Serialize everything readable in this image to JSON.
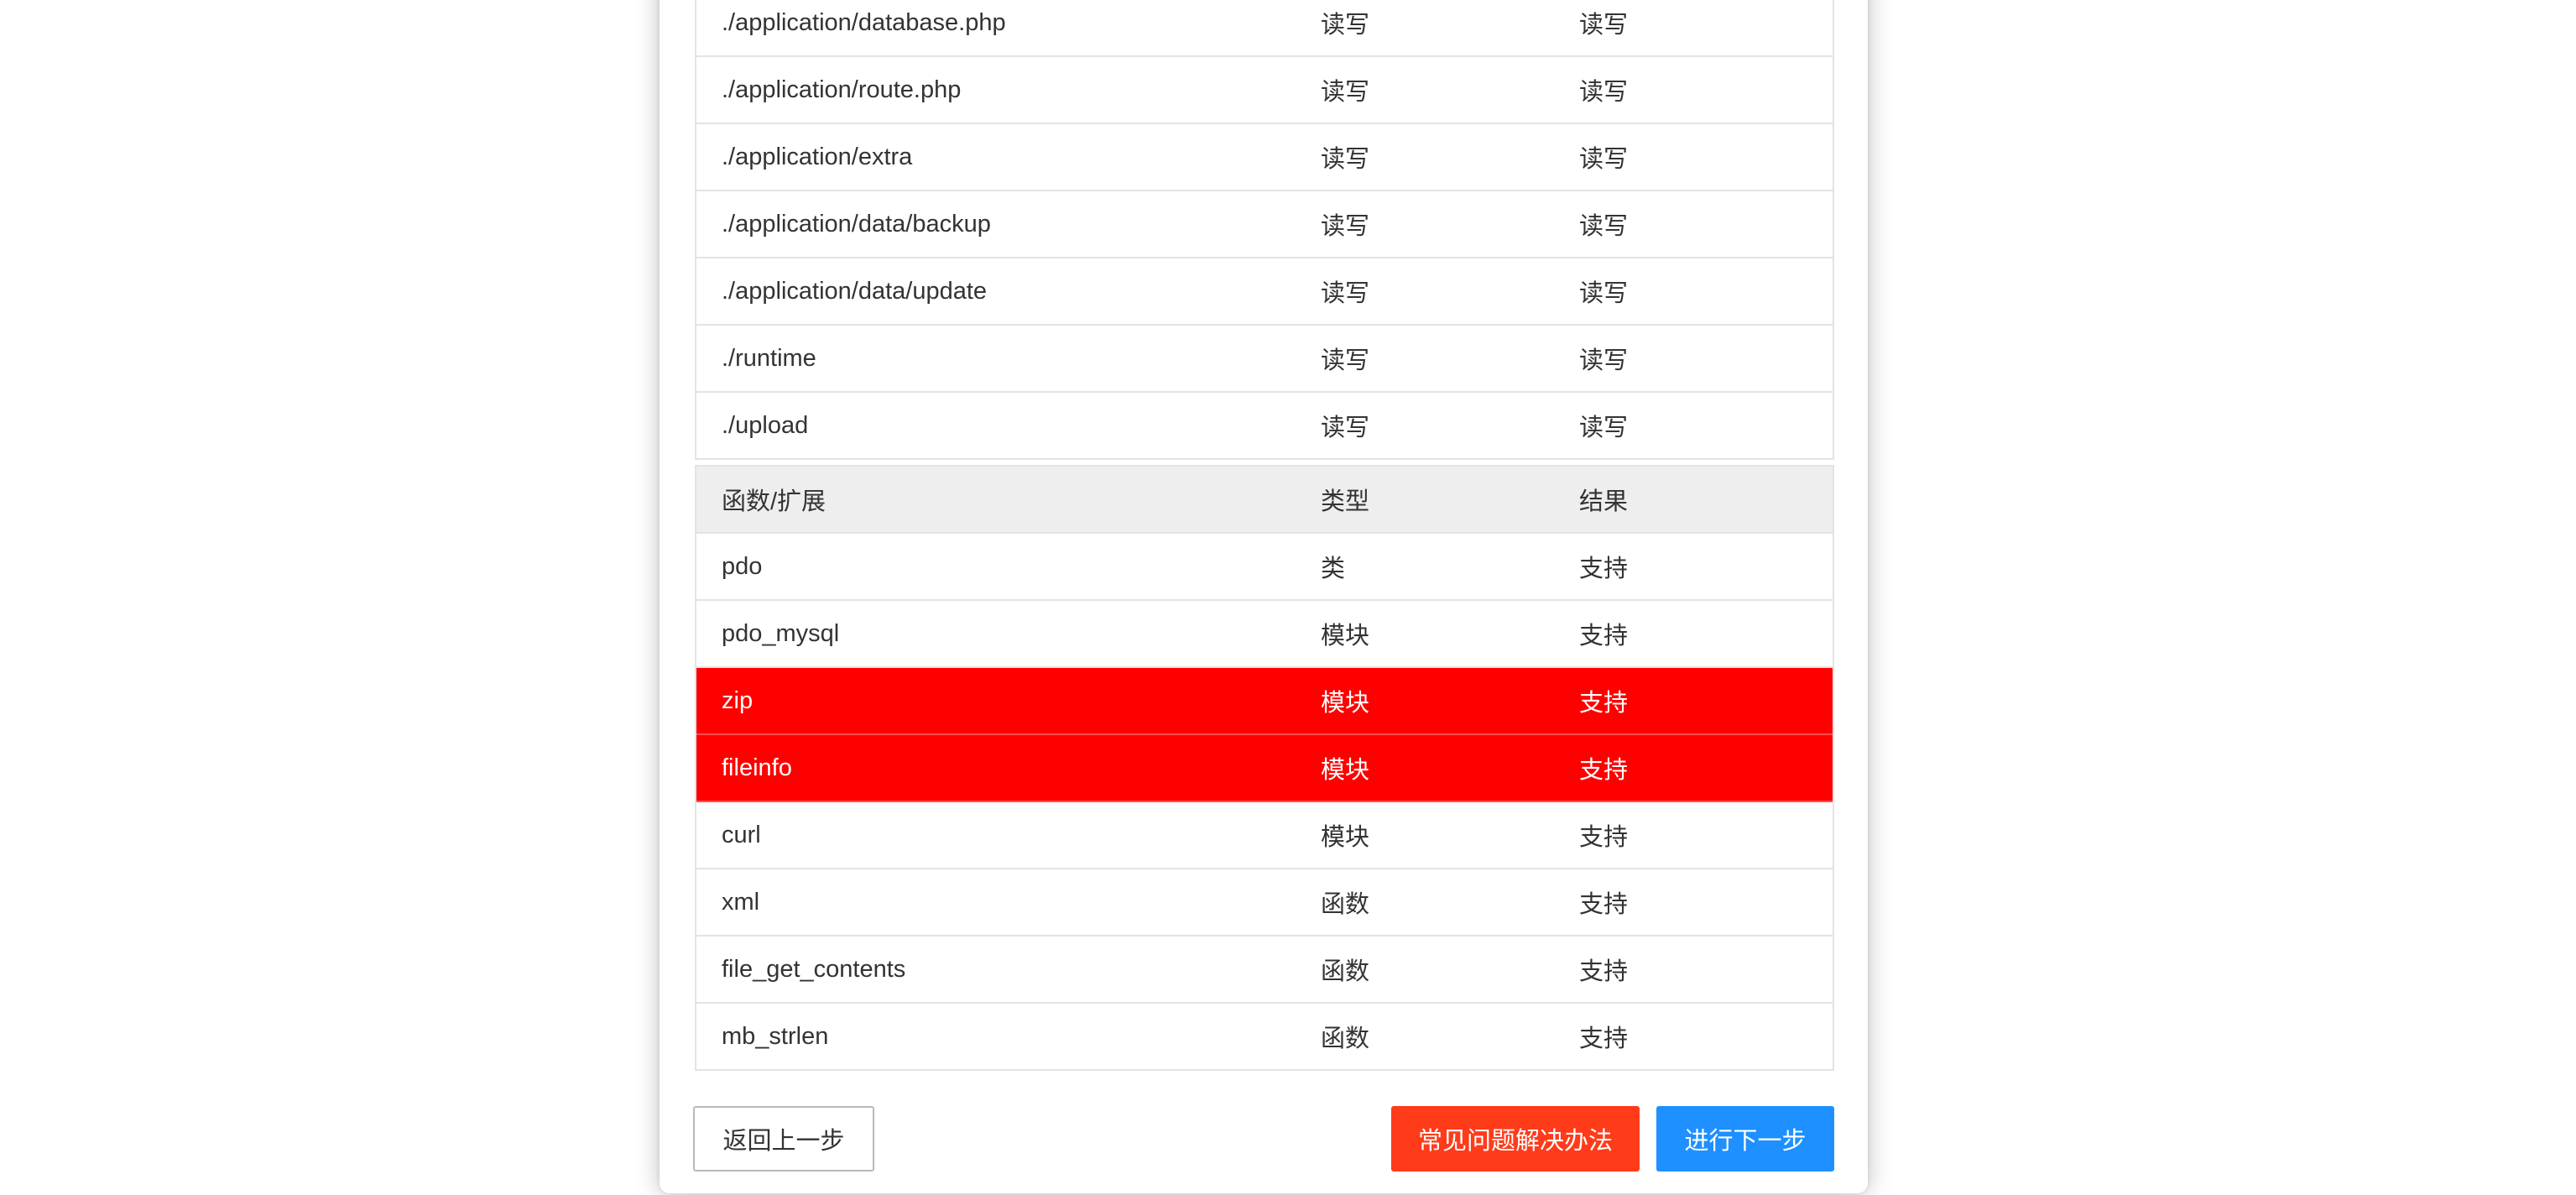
{
  "directories": {
    "rows": [
      {
        "path": "./application/database.php",
        "required": "读写",
        "current": "读写"
      },
      {
        "path": "./application/route.php",
        "required": "读写",
        "current": "读写"
      },
      {
        "path": "./application/extra",
        "required": "读写",
        "current": "读写"
      },
      {
        "path": "./application/data/backup",
        "required": "读写",
        "current": "读写"
      },
      {
        "path": "./application/data/update",
        "required": "读写",
        "current": "读写"
      },
      {
        "path": "./runtime",
        "required": "读写",
        "current": "读写"
      },
      {
        "path": "./upload",
        "required": "读写",
        "current": "读写"
      }
    ]
  },
  "extensions": {
    "headers": {
      "name": "函数/扩展",
      "type": "类型",
      "result": "结果"
    },
    "highlight_color": "#ff0000",
    "rows": [
      {
        "name": "pdo",
        "type": "类",
        "result": "支持",
        "highlighted": false
      },
      {
        "name": "pdo_mysql",
        "type": "模块",
        "result": "支持",
        "highlighted": false
      },
      {
        "name": "zip",
        "type": "模块",
        "result": "支持",
        "highlighted": true
      },
      {
        "name": "fileinfo",
        "type": "模块",
        "result": "支持",
        "highlighted": true
      },
      {
        "name": "curl",
        "type": "模块",
        "result": "支持",
        "highlighted": false
      },
      {
        "name": "xml",
        "type": "函数",
        "result": "支持",
        "highlighted": false
      },
      {
        "name": "file_get_contents",
        "type": "函数",
        "result": "支持",
        "highlighted": false
      },
      {
        "name": "mb_strlen",
        "type": "函数",
        "result": "支持",
        "highlighted": false
      }
    ]
  },
  "buttons": {
    "back_label": "返回上一步",
    "faq_label": "常见问题解决办法",
    "next_label": "进行下一步",
    "faq_color": "#ff3b1a",
    "next_color": "#1e90ff"
  }
}
